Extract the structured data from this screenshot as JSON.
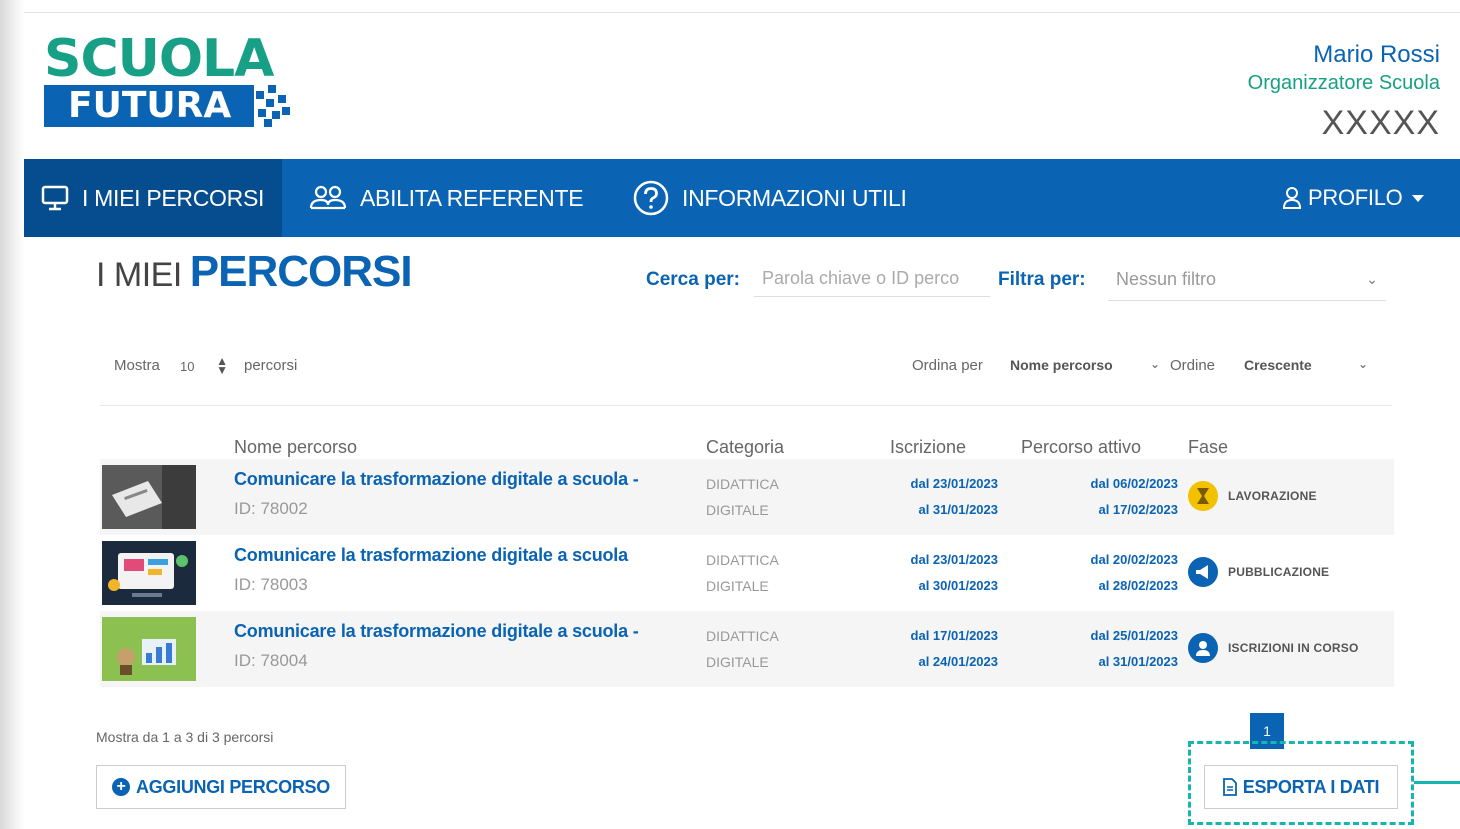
{
  "logo": {
    "line1": "SCUOLA",
    "line2": "FUTURA"
  },
  "user": {
    "name": "Mario Rossi",
    "role": "Organizzatore Scuola",
    "code": "XXXXX"
  },
  "nav": {
    "items": [
      {
        "label": "I MIEI PERCORSI",
        "icon": "monitor-icon"
      },
      {
        "label": "ABILITA REFERENTE",
        "icon": "users-icon"
      },
      {
        "label": "INFORMAZIONI UTILI",
        "icon": "question-circle-icon"
      }
    ],
    "profile": {
      "label": "PROFILO",
      "icon": "user-icon"
    }
  },
  "page": {
    "title_light": "I MIEI",
    "title_bold": "PERCORSI"
  },
  "search": {
    "label": "Cerca per:",
    "placeholder": "Parola chiave o ID perco"
  },
  "filter": {
    "label": "Filtra per:",
    "value": "Nessun filtro"
  },
  "controls": {
    "show_label": "Mostra",
    "show_value": "10",
    "show_suffix": "percorsi",
    "sort_label": "Ordina per",
    "sort_value": "Nome percorso",
    "order_label": "Ordine",
    "order_value": "Crescente"
  },
  "table": {
    "headers": [
      "Nome percorso",
      "Categoria",
      "Iscrizione",
      "Percorso attivo",
      "Fase"
    ],
    "rows": [
      {
        "name": "Comunicare la trasformazione digitale a scuola -",
        "id": "ID: 78002",
        "cat1": "DIDATTICA",
        "cat2": "DIGITALE",
        "iscr_from": "dal 23/01/2023",
        "iscr_to": "al 31/01/2023",
        "att_from": "dal 06/02/2023",
        "att_to": "al 17/02/2023",
        "phase": "LAVORAZIONE",
        "phase_icon": "hourglass-icon",
        "phase_color": "#f2c200"
      },
      {
        "name": "Comunicare la trasformazione digitale a scuola",
        "id": "ID: 78003",
        "cat1": "DIDATTICA",
        "cat2": "DIGITALE",
        "iscr_from": "dal 23/01/2023",
        "iscr_to": "al 30/01/2023",
        "att_from": "dal 20/02/2023",
        "att_to": "al 28/02/2023",
        "phase": "PUBBLICAZIONE",
        "phase_icon": "megaphone-icon",
        "phase_color": "#0a63b3"
      },
      {
        "name": "Comunicare la trasformazione digitale a scuola -",
        "id": "ID: 78004",
        "cat1": "DIDATTICA",
        "cat2": "DIGITALE",
        "iscr_from": "dal 17/01/2023",
        "iscr_to": "al 24/01/2023",
        "att_from": "dal 25/01/2023",
        "att_to": "al 31/01/2023",
        "phase": "ISCRIZIONI IN CORSO",
        "phase_icon": "person-icon",
        "phase_color": "#0a63b3"
      }
    ]
  },
  "footer": {
    "info": "Mostra da 1 a 3 di 3 percorsi",
    "add_button": "AGGIUNGI PERCORSO",
    "page_number": "1",
    "export_button": "ESPORTA I DATI"
  },
  "colors": {
    "primary": "#0a63b3",
    "primary_dark": "#064d90",
    "brand_green": "#17a085",
    "highlight": "#17b5b0"
  }
}
